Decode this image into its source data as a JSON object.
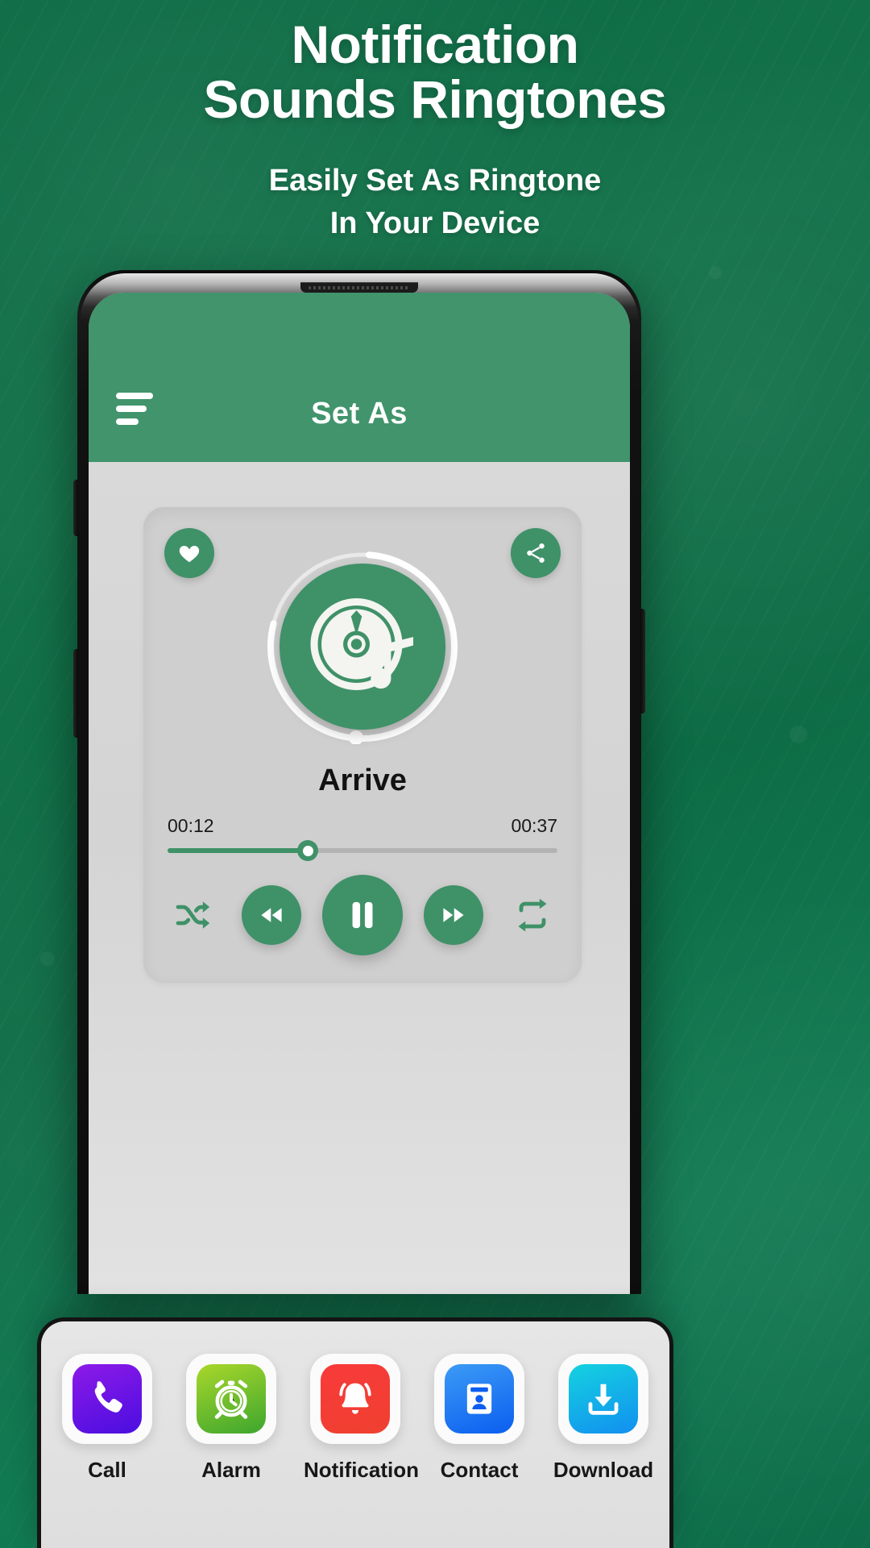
{
  "promo": {
    "title_line1": "Notification",
    "title_line2": "Sounds Ringtones",
    "subtitle_line1": "Easily Set As Ringtone",
    "subtitle_line2": "In Your Device"
  },
  "app": {
    "appbar": {
      "title": "Set As",
      "menu_icon": "hamburger-menu-icon"
    },
    "player": {
      "favorite_icon": "heart-icon",
      "share_icon": "share-icon",
      "artwork_icon": "cd-music-note-icon",
      "song_title": "Arrive",
      "current_time": "00:12",
      "total_time": "00:37",
      "progress_percent": 36,
      "ring_progress_percent": 78,
      "controls": [
        {
          "name": "shuffle",
          "icon": "shuffle-icon",
          "style": "flat"
        },
        {
          "name": "rewind",
          "icon": "rewind-icon",
          "style": "circ"
        },
        {
          "name": "pause",
          "icon": "pause-icon",
          "style": "big"
        },
        {
          "name": "forward",
          "icon": "fast-forward-icon",
          "style": "circ"
        },
        {
          "name": "repeat",
          "icon": "repeat-icon",
          "style": "flat"
        }
      ]
    },
    "dock": [
      {
        "label": "Call",
        "icon": "phone-icon",
        "color_from": "#8d1ae8",
        "color_to": "#4a0ee0"
      },
      {
        "label": "Alarm",
        "icon": "alarm-clock-icon",
        "color_from": "#a9d72b",
        "color_to": "#3da62e"
      },
      {
        "label": "Notification",
        "icon": "bell-icon",
        "color_from": "#f83a3a",
        "color_to": "#ef4030"
      },
      {
        "label": "Contact",
        "icon": "contact-card-icon",
        "color_from": "#3c9bf5",
        "color_to": "#0b5ef0"
      },
      {
        "label": "Download",
        "icon": "download-icon",
        "color_from": "#14d2e0",
        "color_to": "#128ff0"
      }
    ]
  },
  "colors": {
    "brand_green": "#3f9168",
    "background_green": "#0e6c45",
    "card_gray": "#cfcfcf"
  }
}
